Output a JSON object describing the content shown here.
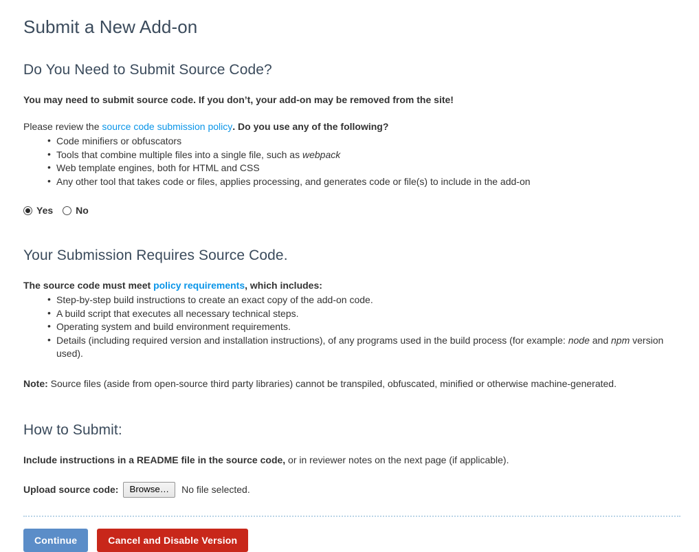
{
  "page": {
    "title": "Submit a New Add-on"
  },
  "source_code_section": {
    "heading": "Do You Need to Submit Source Code?",
    "lead": "You may need to submit source code. If you don’t, your add-on may be removed from the site!",
    "intro_prefix": "Please review the ",
    "policy_link": "source code submission policy",
    "intro_suffix_bold": ". Do you use any of the following?",
    "bullets": [
      {
        "text_before": "Code minifiers or obfuscators",
        "italic": "",
        "text_after": ""
      },
      {
        "text_before": "Tools that combine multiple files into a single file, such as ",
        "italic": "webpack",
        "text_after": ""
      },
      {
        "text_before": "Web template engines, both for HTML and CSS",
        "italic": "",
        "text_after": ""
      },
      {
        "text_before": "Any other tool that takes code or files, applies processing, and generates code or file(s) to include in the add-on",
        "italic": "",
        "text_after": ""
      }
    ],
    "radios": [
      {
        "label": "Yes",
        "checked": true
      },
      {
        "label": "No",
        "checked": false
      }
    ]
  },
  "requires_section": {
    "heading": "Your Submission Requires Source Code.",
    "intro_prefix": "The source code must meet ",
    "policy_link": "policy requirements",
    "intro_suffix": ", which includes:",
    "bullets": [
      {
        "text_before": "Step-by-step build instructions to create an exact copy of the add-on code.",
        "italic": "",
        "text_after": "",
        "italic2": "",
        "text_after2": ""
      },
      {
        "text_before": "A build script that executes all necessary technical steps.",
        "italic": "",
        "text_after": "",
        "italic2": "",
        "text_after2": ""
      },
      {
        "text_before": "Operating system and build environment requirements.",
        "italic": "",
        "text_after": "",
        "italic2": "",
        "text_after2": ""
      },
      {
        "text_before": "Details (including required version and installation instructions), of any programs used in the build process (for example: ",
        "italic": "node",
        "text_after": " and ",
        "italic2": "npm",
        "text_after2": " version used)."
      }
    ],
    "note_label": "Note:",
    "note_text": " Source files (aside from open-source third party libraries) cannot be transpiled, obfuscated, minified or otherwise machine-generated."
  },
  "how_to_submit_section": {
    "heading": "How to Submit:",
    "instruction_bold": "Include instructions in a README file in the source code,",
    "instruction_rest": " or in reviewer notes on the next page (if applicable).",
    "upload_label": "Upload source code:",
    "browse_button": "Browse…",
    "no_file_text": "No file selected."
  },
  "actions": {
    "continue_label": "Continue",
    "cancel_label": "Cancel and Disable Version"
  },
  "colors": {
    "heading": "#3b4b5c",
    "link": "#0a95e8",
    "continue_button": "#5b8dc8",
    "cancel_button": "#c8271a",
    "divider": "#b9d4e6",
    "body_text": "#333333"
  }
}
